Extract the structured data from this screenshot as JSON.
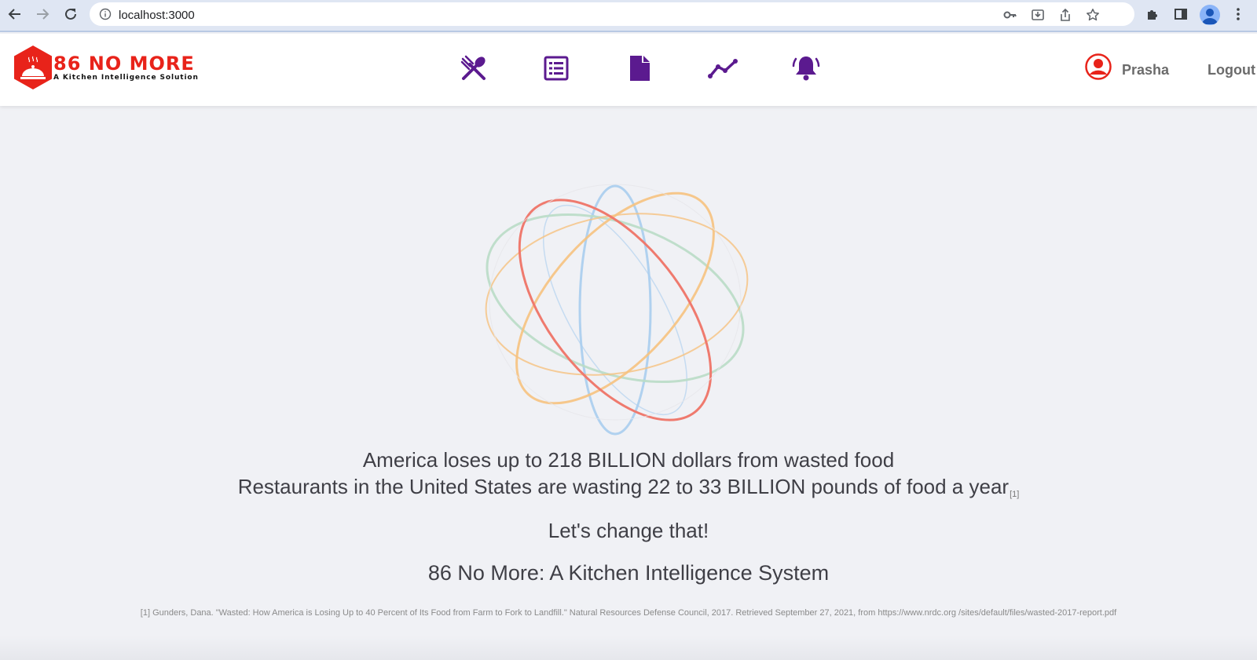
{
  "browser": {
    "url": "localhost:3000"
  },
  "header": {
    "brand_name": "86 NO MORE",
    "brand_tagline": "A Kitchen Intelligence Solution",
    "nav_icons": [
      "utensils-icon",
      "list-icon",
      "file-icon",
      "trend-chart-icon",
      "bell-icon"
    ],
    "user_name": "Prasha",
    "logout_label": "Logout"
  },
  "colors": {
    "brand_red": "#e8231a",
    "nav_purple": "#5b1a8f",
    "orbit_red": "#ef7a6e",
    "orbit_orange": "#f6c280",
    "orbit_green": "#b9dcc7",
    "orbit_blue": "#a8cdee"
  },
  "main": {
    "line1": "America loses up to 218 BILLION dollars from wasted food",
    "line2": "Restaurants in the United States are wasting 22 to 33 BILLION pounds of food a year",
    "footnote_marker": "[1]",
    "line3": "Let's change that!",
    "line4": "86 No More: A Kitchen Intelligence System",
    "citation": "[1] Gunders, Dana. \"Wasted: How America is Losing Up to 40 Percent of Its Food from Farm to Fork to Landfill.\" Natural Resources Defense Council, 2017. Retrieved September 27, 2021, from https://www.nrdc.org /sites/default/files/wasted-2017-report.pdf"
  }
}
